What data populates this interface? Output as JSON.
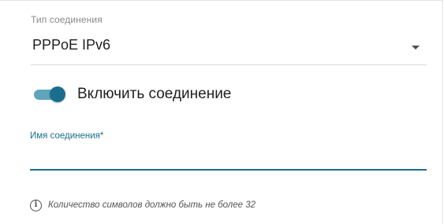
{
  "connection_type": {
    "label": "Тип соединения",
    "value": "PPPoE IPv6",
    "arrow_icon": "caret-down-icon"
  },
  "enable_toggle": {
    "label": "Включить соединение",
    "state": "on",
    "color_on": "#1a6e8c"
  },
  "connection_name": {
    "label": "Имя соединения*",
    "value": "",
    "accent_color": "#1a6e8c"
  },
  "hint": {
    "icon": "info-icon",
    "text": "Количество символов должно быть не более 32"
  }
}
